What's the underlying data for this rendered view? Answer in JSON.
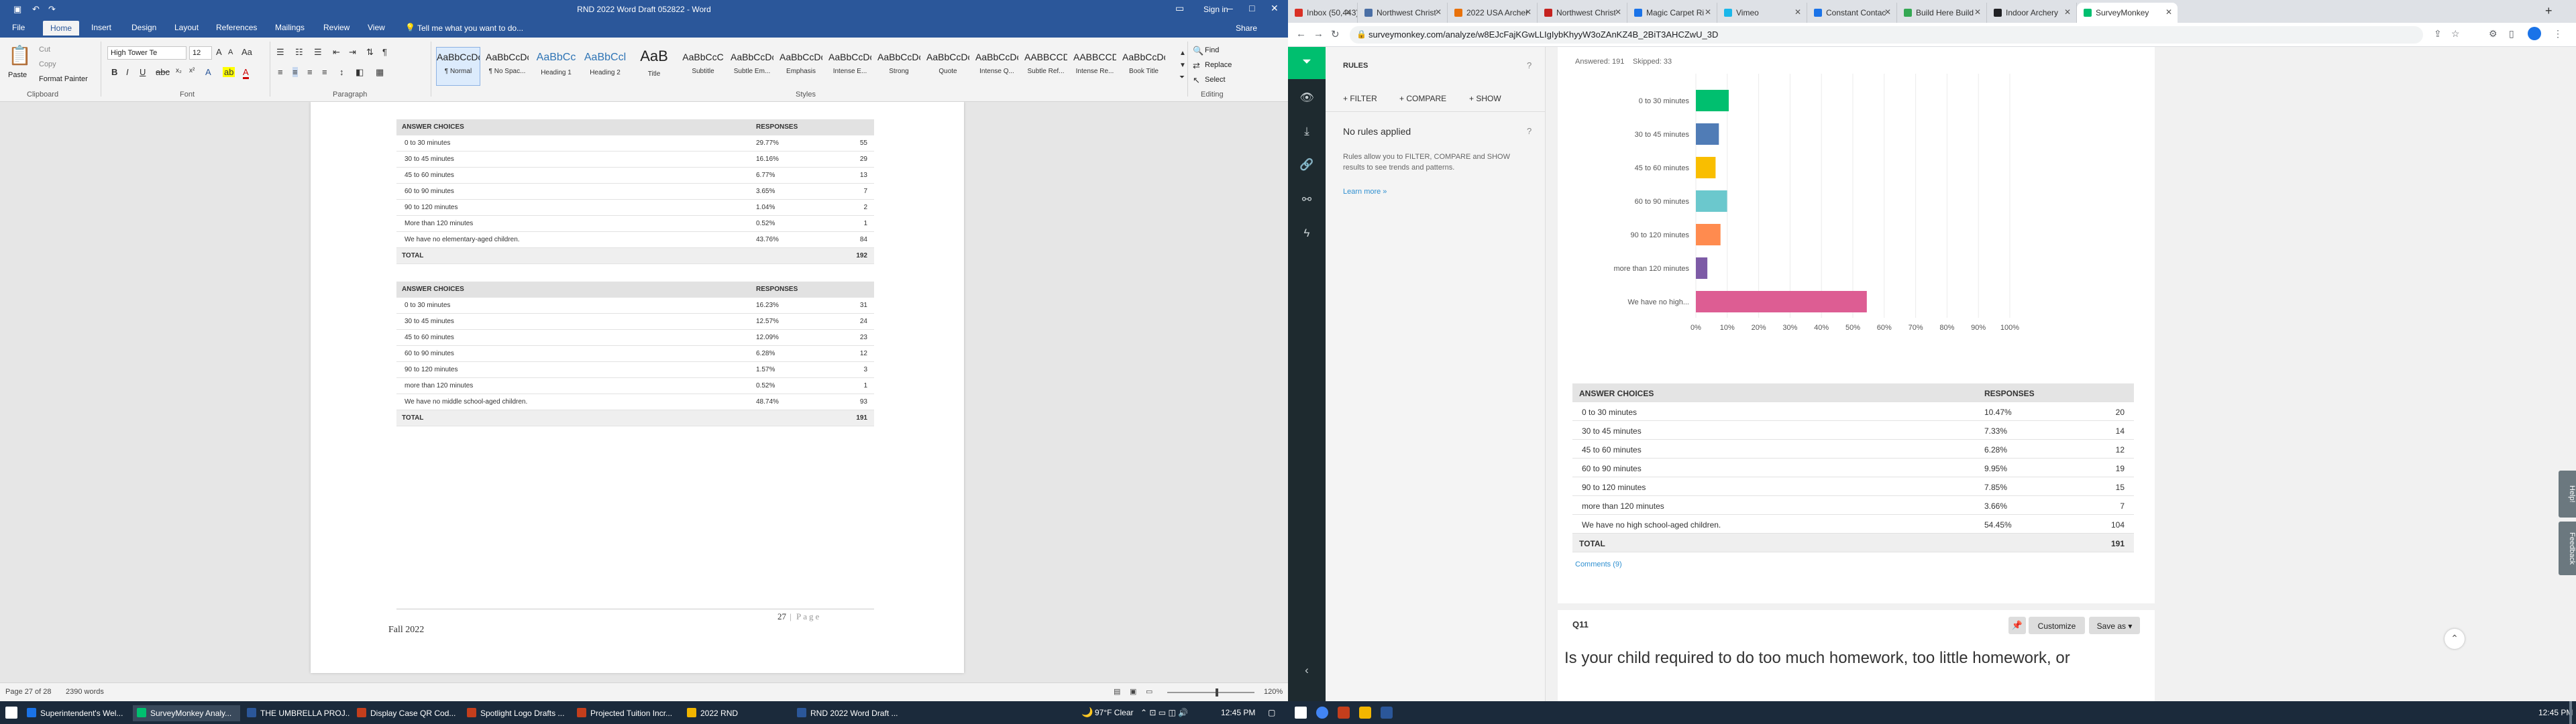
{
  "word": {
    "window_title": "RND 2022 Word Draft 052822  -  Word",
    "sign_in": "Sign in",
    "share": "Share",
    "tabs": [
      "File",
      "Home",
      "Insert",
      "Design",
      "Layout",
      "References",
      "Mailings",
      "Review",
      "View"
    ],
    "tell_me": "Tell me what you want to do...",
    "clipboard": {
      "paste": "Paste",
      "cut": "Cut",
      "copy": "Copy",
      "format_painter": "Format Painter",
      "label": "Clipboard"
    },
    "font": {
      "name": "High Tower Te",
      "size": "12",
      "label": "Font"
    },
    "paragraph_label": "Paragraph",
    "styles_label": "Styles",
    "styles": [
      {
        "preview": "AaBbCcDc",
        "name": "¶ Normal"
      },
      {
        "preview": "AaBbCcDc",
        "name": "¶ No Spac..."
      },
      {
        "preview": "AaBbCc",
        "name": "Heading 1"
      },
      {
        "preview": "AaBbCcl",
        "name": "Heading 2"
      },
      {
        "preview": "AaB",
        "name": "Title"
      },
      {
        "preview": "AaBbCcC",
        "name": "Subtitle"
      },
      {
        "preview": "AaBbCcDc",
        "name": "Subtle Em..."
      },
      {
        "preview": "AaBbCcDc",
        "name": "Emphasis"
      },
      {
        "preview": "AaBbCcDc",
        "name": "Intense E..."
      },
      {
        "preview": "AaBbCcDc",
        "name": "Strong"
      },
      {
        "preview": "AaBbCcDc",
        "name": "Quote"
      },
      {
        "preview": "AaBbCcDc",
        "name": "Intense Q..."
      },
      {
        "preview": "AABBCCDC",
        "name": "Subtle Ref..."
      },
      {
        "preview": "AABBCCDC",
        "name": "Intense Re..."
      },
      {
        "preview": "AaBbCcDc",
        "name": "Book Title"
      }
    ],
    "editing": {
      "find": "Find",
      "replace": "Replace",
      "select": "Select",
      "label": "Editing"
    },
    "table1": {
      "header": [
        "ANSWER CHOICES",
        "RESPONSES"
      ],
      "rows": [
        [
          "0 to 30 minutes",
          "29.77%",
          "55"
        ],
        [
          "30 to 45 minutes",
          "16.16%",
          "29"
        ],
        [
          "45 to 60 minutes",
          "6.77%",
          "13"
        ],
        [
          "60 to 90 minutes",
          "3.65%",
          "7"
        ],
        [
          "90 to 120 minutes",
          "1.04%",
          "2"
        ],
        [
          "More than 120 minutes",
          "0.52%",
          "1"
        ],
        [
          "We have no elementary-aged children.",
          "43.76%",
          "84"
        ]
      ],
      "total": [
        "TOTAL",
        "192"
      ]
    },
    "table2": {
      "header": [
        "ANSWER CHOICES",
        "RESPONSES"
      ],
      "rows": [
        [
          "0 to 30 minutes",
          "16.23%",
          "31"
        ],
        [
          "30 to 45 minutes",
          "12.57%",
          "24"
        ],
        [
          "45 to 60 minutes",
          "12.09%",
          "23"
        ],
        [
          "60 to 90 minutes",
          "6.28%",
          "12"
        ],
        [
          "90 to 120 minutes",
          "1.57%",
          "3"
        ],
        [
          "more than 120 minutes",
          "0.52%",
          "1"
        ],
        [
          "We have no middle school-aged children.",
          "48.74%",
          "93"
        ]
      ],
      "total": [
        "TOTAL",
        "191"
      ]
    },
    "footer_left": "Fall 2022",
    "footer_page": "27",
    "footer_page_word": "Page",
    "status": {
      "page": "Page 27 of 28",
      "words": "2390 words",
      "zoom": "120%"
    }
  },
  "browser": {
    "tabs": [
      {
        "label": "Inbox (50,443)",
        "color": "#d93025"
      },
      {
        "label": "Northwest Christ",
        "color": "#4a6fa5"
      },
      {
        "label": "2022 USA Archer",
        "color": "#e8710a"
      },
      {
        "label": "Northwest Christ",
        "color": "#c5221f"
      },
      {
        "label": "Magic Carpet Ri",
        "color": "#1a73e8"
      },
      {
        "label": "Vimeo",
        "color": "#1ab7ea"
      },
      {
        "label": "Constant Contac",
        "color": "#1a73e8"
      },
      {
        "label": "Build Here Build",
        "color": "#34a853"
      },
      {
        "label": "Indoor Archery",
        "color": "#202124"
      },
      {
        "label": "SurveyMonkey",
        "color": "#00bf6f"
      }
    ],
    "url": "surveymonkey.com/analyze/w8EJcFajKGwLLIgIybKhyyW3oZAnKZ4B_2BiT3AHCZwU_3D"
  },
  "survey": {
    "rules_title": "RULES",
    "filter": "+ FILTER",
    "compare": "+ COMPARE",
    "show": "+ SHOW",
    "no_rules_title": "No rules applied",
    "no_rules_text": "Rules allow you to FILTER, COMPARE and SHOW results to see trends and patterns.",
    "learn_more": "Learn more »",
    "answered": "Answered: 191",
    "skipped": "Skipped: 33",
    "table": {
      "header": [
        "ANSWER CHOICES",
        "RESPONSES"
      ],
      "rows": [
        [
          "0 to 30 minutes",
          "10.47%",
          "20"
        ],
        [
          "30 to 45 minutes",
          "7.33%",
          "14"
        ],
        [
          "45 to 60 minutes",
          "6.28%",
          "12"
        ],
        [
          "60 to 90 minutes",
          "9.95%",
          "19"
        ],
        [
          "90 to 120 minutes",
          "7.85%",
          "15"
        ],
        [
          "more than 120 minutes",
          "3.66%",
          "7"
        ],
        [
          "We have no high school-aged children.",
          "54.45%",
          "104"
        ]
      ],
      "total": [
        "TOTAL",
        "191"
      ]
    },
    "comments": "Comments (9)",
    "q11_label": "Q11",
    "customize": "Customize",
    "save_as": "Save as",
    "q11_text": "Is your child required to do too much homework, too little homework, or",
    "help_tab": "Help!",
    "feedback_tab": "Feedback"
  },
  "chart_data": {
    "type": "bar",
    "orientation": "horizontal",
    "categories": [
      "0 to 30 minutes",
      "30 to 45 minutes",
      "45 to 60 minutes",
      "60 to 90 minutes",
      "90 to 120 minutes",
      "more than 120 minutes",
      "We have no high..."
    ],
    "values": [
      10.47,
      7.33,
      6.28,
      9.95,
      7.85,
      3.66,
      54.45
    ],
    "colors": [
      "#00bf6f",
      "#507cb6",
      "#f9be00",
      "#6bc8cd",
      "#ff8b4f",
      "#7d5ba6",
      "#dd5d93"
    ],
    "xlim": [
      0,
      100
    ],
    "x_ticks": [
      "0%",
      "10%",
      "20%",
      "30%",
      "40%",
      "50%",
      "60%",
      "70%",
      "80%",
      "90%",
      "100%"
    ]
  },
  "taskbar": {
    "items": [
      {
        "label": "Superintendent's Wel...",
        "color": "#1a73e8"
      },
      {
        "label": "SurveyMonkey Analy...",
        "color": "#00bf6f"
      },
      {
        "label": "THE UMBRELLA PROJ...",
        "color": "#2b579a"
      },
      {
        "label": "Display Case QR Cod...",
        "color": "#c43e1c"
      },
      {
        "label": "Spotlight Logo Drafts ...",
        "color": "#c43e1c"
      },
      {
        "label": "Projected Tuition Incr...",
        "color": "#c43e1c"
      },
      {
        "label": "2022 RND",
        "color": "#f2b600"
      },
      {
        "label": "RND 2022 Word Draft ...",
        "color": "#2b579a"
      }
    ],
    "weather": "97°F  Clear",
    "time": "12:45 PM",
    "time2": "12:45 PM"
  }
}
